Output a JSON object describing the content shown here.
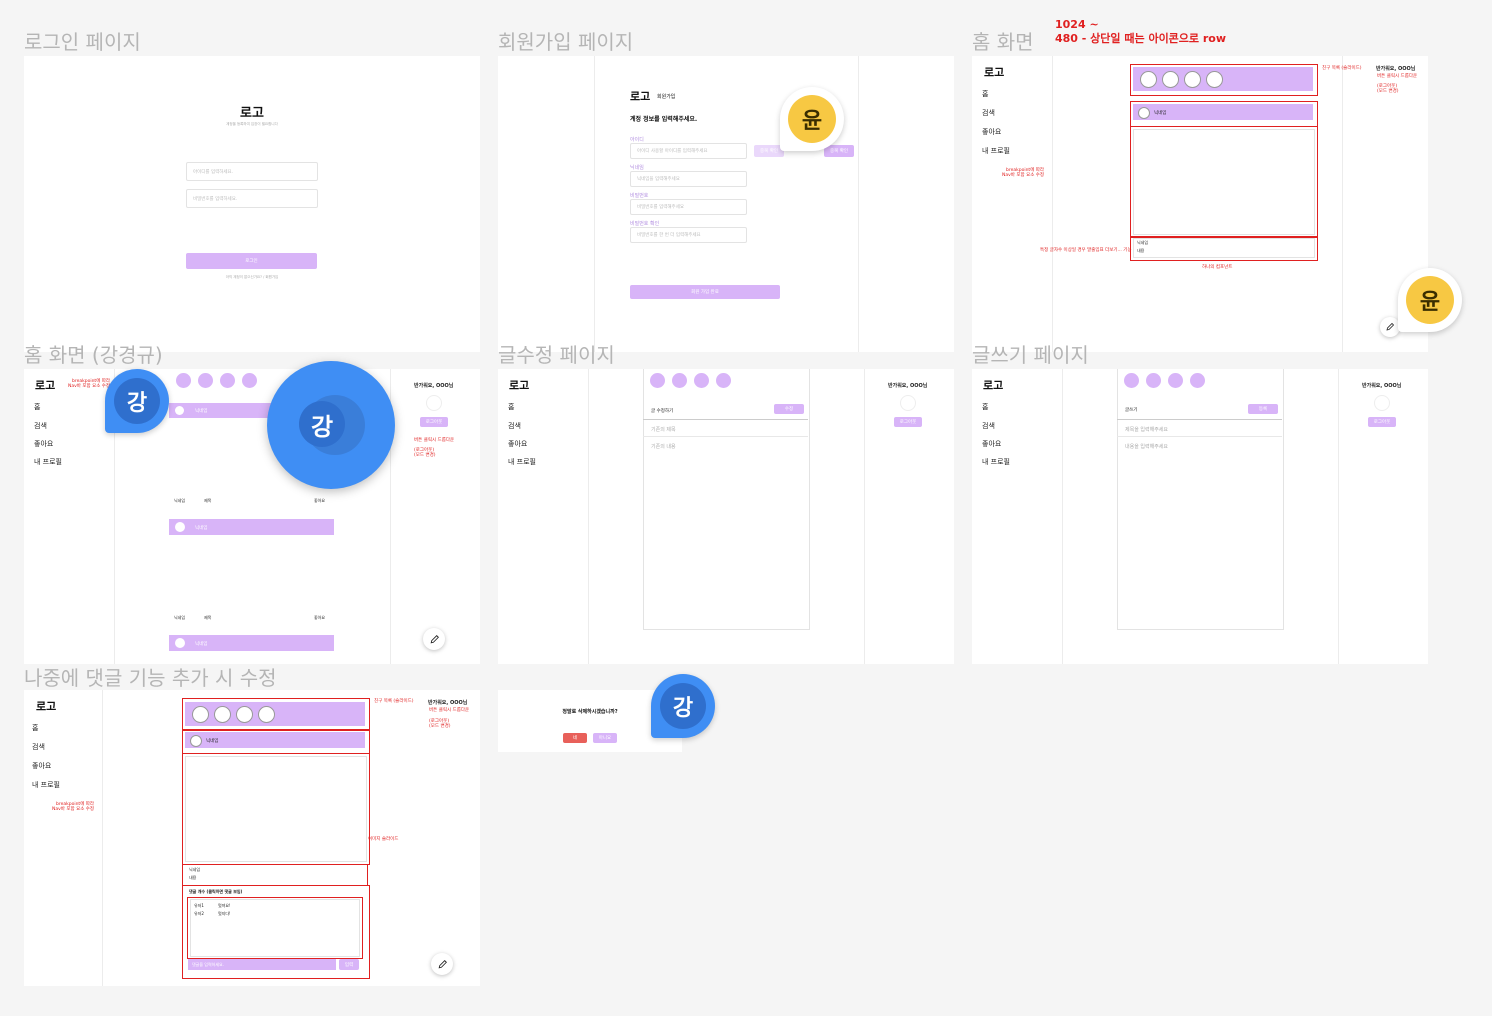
{
  "frames": {
    "login": {
      "title": "로그인 페이지",
      "logo": "로고",
      "subtitle": "계정을 등록하여 입장이 필요합니다",
      "id_placeholder": "아이디를 입력하세요.",
      "pw_placeholder": "비밀번호를 입력하세요.",
      "login_button": "로그인",
      "footer_text": "아직 계정이 없으신가요? / 회원가입"
    },
    "signup": {
      "title": "회원가입 페이지",
      "logo": "로고",
      "logo_sub": "회원가입",
      "heading": "계정 정보를 입력해주세요.",
      "id_label": "아이디",
      "id_placeholder": "아이디 사용할 아이디를 입력해주세요",
      "check_button": "중복 확인",
      "nick_label": "닉네임",
      "nick_placeholder": "닉네임을 입력해주세요",
      "pw_label": "비밀번호",
      "pw_placeholder": "비밀번호를 입력해주세요",
      "pw2_label": "비밀번호 확인",
      "pw2_placeholder": "비밀번호를 한 번 더 입력해주세요",
      "submit_button": "회원 가입 완료"
    },
    "home": {
      "title": "홈 화면",
      "logo": "로고",
      "nav": [
        "홈",
        "검색",
        "좋아요",
        "내 프로필"
      ],
      "greeting": "반가워요, OOO님",
      "note_top_line1": "1024 ~",
      "note_top_line2": "480  - 상단일 때는 아이콘으로 row",
      "note_friends": "친구 목록 (슬라이드)",
      "note_btn": "버튼 클릭시 드롭다운",
      "note_dropdown": "(로그아웃)\n(모드 변경)",
      "note_breakpoint": "breakpoint에 따라\nNav바 포함 요소 수정",
      "post_nickname": "닉네임",
      "post_author": "닉네임",
      "post_content": "내용",
      "note_bottom": "특정 글자수 이상일 경우 말줄임표 더보기... 기능",
      "note_single": "하나의 컴포넌트"
    },
    "home_kang": {
      "title": "홈 화면 (강경규)",
      "logo": "로고",
      "nav": [
        "홈",
        "검색",
        "좋아요",
        "내 프로필"
      ],
      "greeting": "반가워요, OOO님",
      "note_breakpoint": "breakpoint에 따라\nNav바 포함 요소 수정",
      "logout_button": "로그아웃",
      "note_btn": "버튼 클릭시 드롭다운",
      "note_dropdown": "(로그아웃)\n(모드 변경)",
      "post_nickname": "닉네임",
      "row_nickname": "닉네임",
      "row_title": "제목",
      "row_likes": "좋아요"
    },
    "edit": {
      "title": "글수정 페이지",
      "logo": "로고",
      "nav": [
        "홈",
        "검색",
        "좋아요",
        "내 프로필"
      ],
      "greeting": "반가워요, OOO님",
      "logout_button": "로그아웃",
      "heading": "글 수정하기",
      "submit_button": "수정",
      "title_placeholder": "기존의 제목",
      "body_placeholder": "기존의 내용"
    },
    "write": {
      "title": "글쓰기 페이지",
      "logo": "로고",
      "nav": [
        "홈",
        "검색",
        "좋아요",
        "내 프로필"
      ],
      "greeting": "반가워요, OOO님",
      "logout_button": "로그아웃",
      "heading": "글쓰기",
      "submit_button": "등록",
      "title_placeholder": "제목을 입력해주세요",
      "body_placeholder": "내용을 입력해주세요"
    },
    "comments": {
      "title": "나중에 댓글 기능 추가 시 수정",
      "logo": "로고",
      "nav": [
        "홈",
        "검색",
        "좋아요",
        "내 프로필"
      ],
      "greeting": "반가워요, OOO님",
      "note_friends": "친구 목록 (슬라이드)",
      "note_btn": "버튼 클릭시 드롭다운",
      "note_dropdown": "(로그아웃)\n(모드 변경)",
      "note_breakpoint": "breakpoint에 따라\nNav바 포함 요소 수정",
      "note_image": "이미지 슬라이드",
      "post_nickname": "닉네임",
      "post_author": "닉네임",
      "post_content": "내용",
      "comment_count": "댓글 개수 (클릭하면 댓글 보임)",
      "comments": [
        {
          "user": "유저1",
          "text": "멋져요!"
        },
        {
          "user": "유저2",
          "text": "멋지다!"
        }
      ],
      "comment_placeholder": "댓글을 입력하세요.",
      "comment_button": "입력"
    },
    "delete_modal": {
      "question": "정말로 삭제하시겠습니까?",
      "yes_button": "네",
      "no_button": "아니요"
    }
  },
  "avatars": {
    "yoon": "윤",
    "kang": "강"
  },
  "colors": {
    "accent_purple": "#d8b4f8",
    "annotation_red": "#e02020",
    "yoon_yellow": "#f7c843",
    "kang_blue": "#3f8ef4",
    "delete_red": "#e8605a"
  }
}
